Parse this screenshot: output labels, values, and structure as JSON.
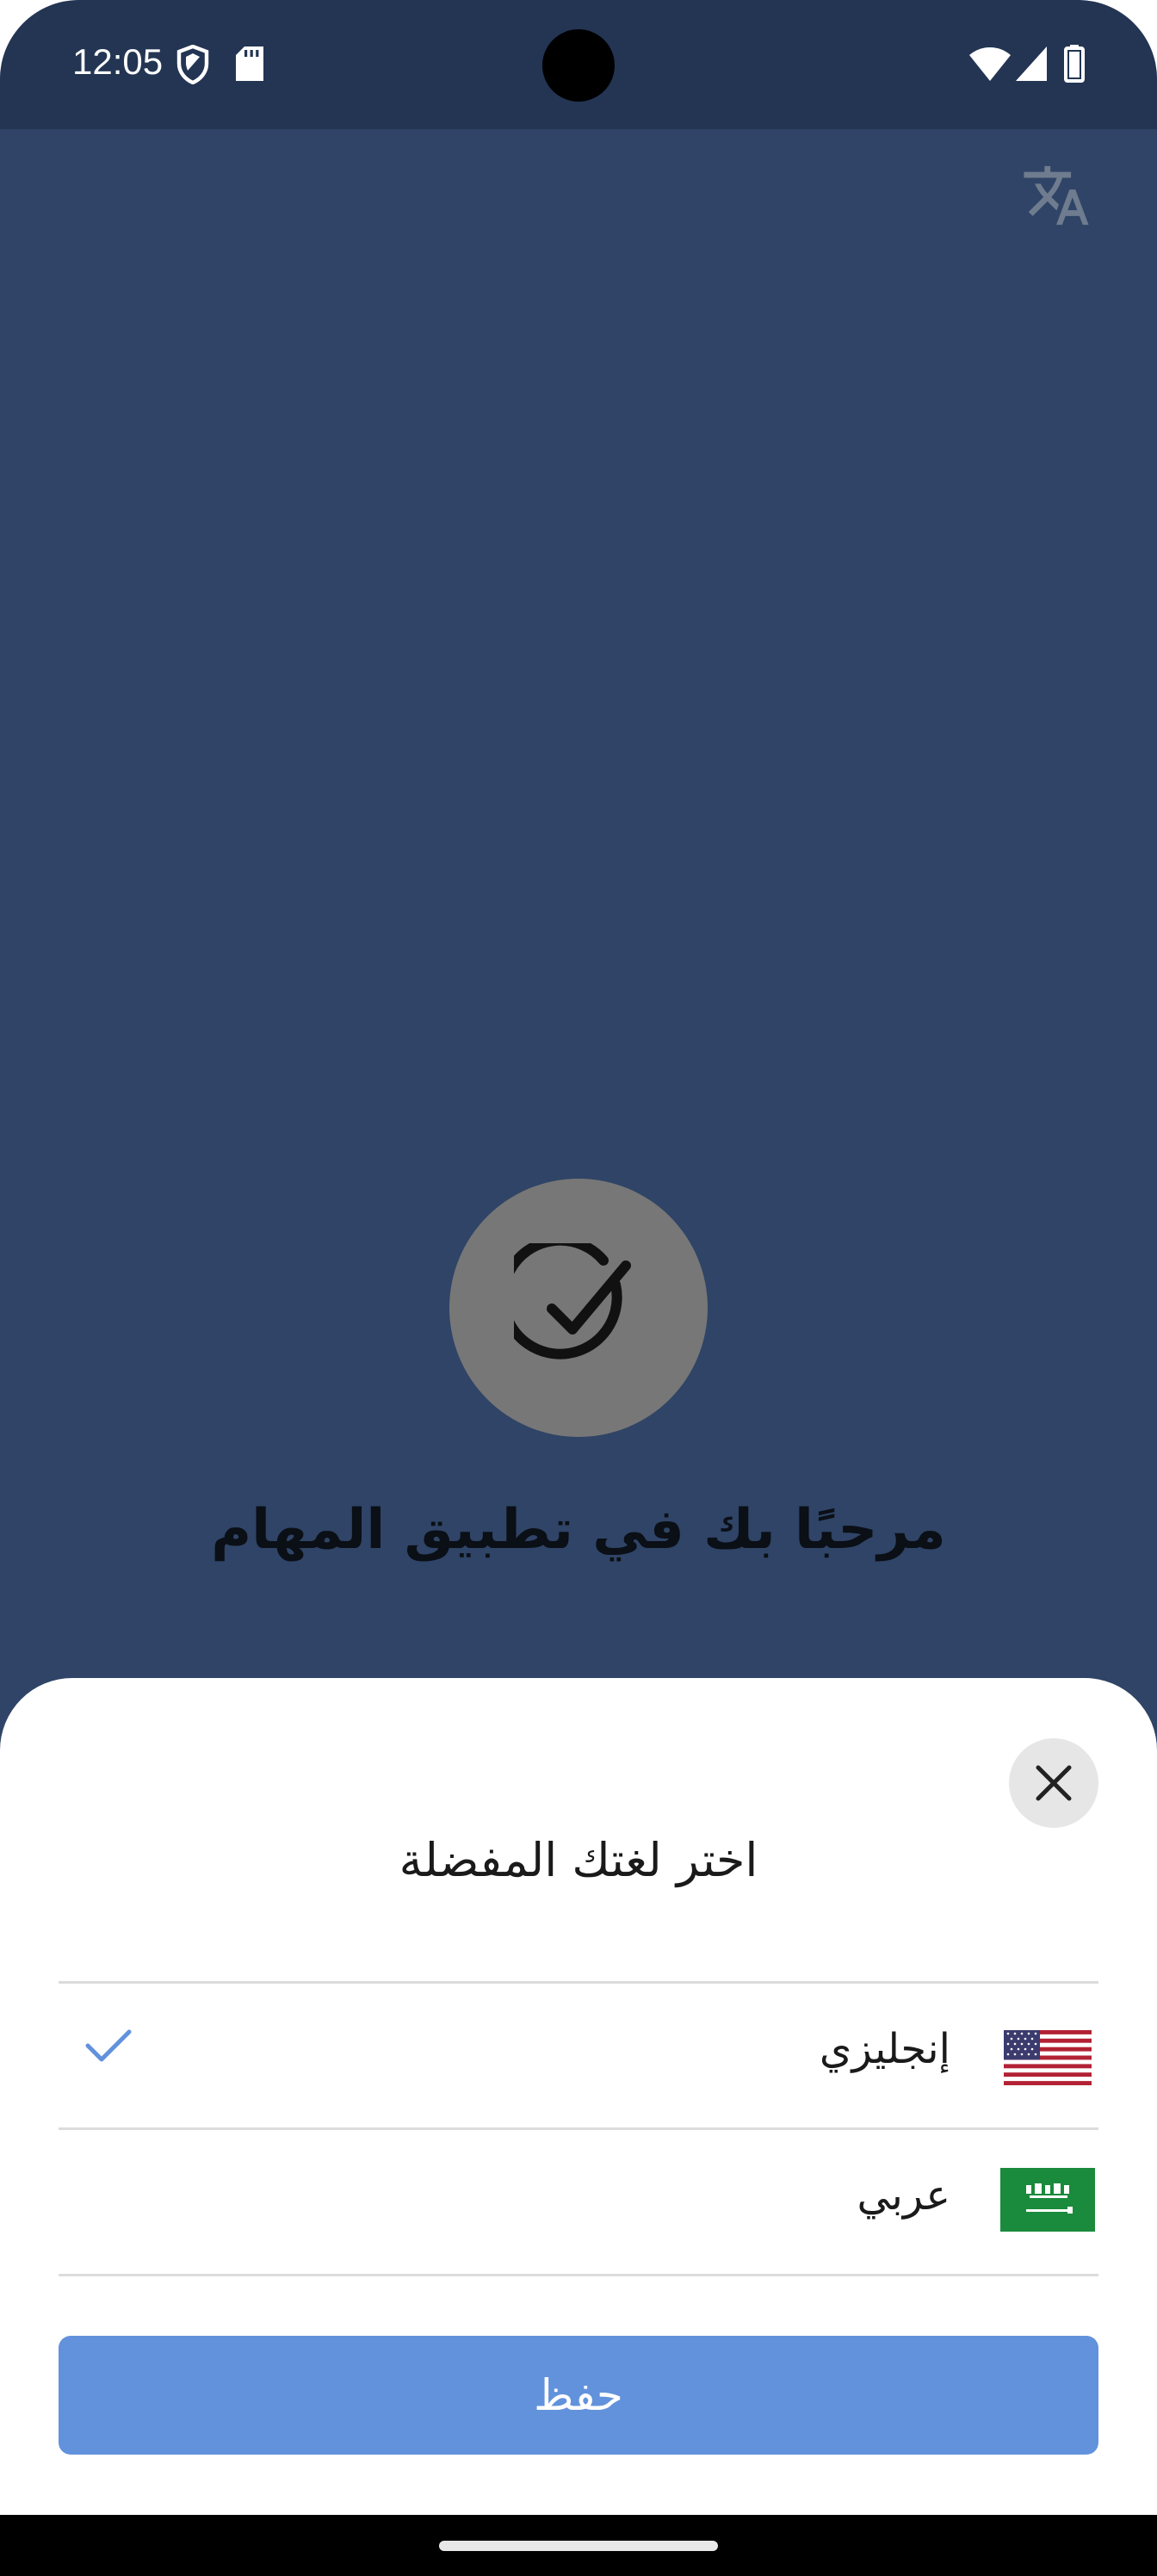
{
  "status_bar": {
    "time": "12:05",
    "icons": [
      "shield-icon",
      "sd-card-icon",
      "wifi-icon",
      "cellular-signal-icon",
      "battery-icon"
    ]
  },
  "header": {
    "translate_icon": "translate-icon"
  },
  "main": {
    "logo_icon": "check-circle-icon",
    "welcome_title": "مرحبًا بك في تطبيق المهام"
  },
  "language_sheet": {
    "title": "اختر لغتك المفضلة",
    "close_icon": "close-icon",
    "languages": [
      {
        "label": "إنجليزي",
        "flag": "us-flag-icon",
        "selected": true
      },
      {
        "label": "عربي",
        "flag": "saudi-flag-icon",
        "selected": false
      }
    ],
    "save_label": "حفظ"
  },
  "colors": {
    "background": "#2f4466",
    "status_bar": "#233553",
    "accent": "#6292dc",
    "sheet": "#ffffff"
  }
}
